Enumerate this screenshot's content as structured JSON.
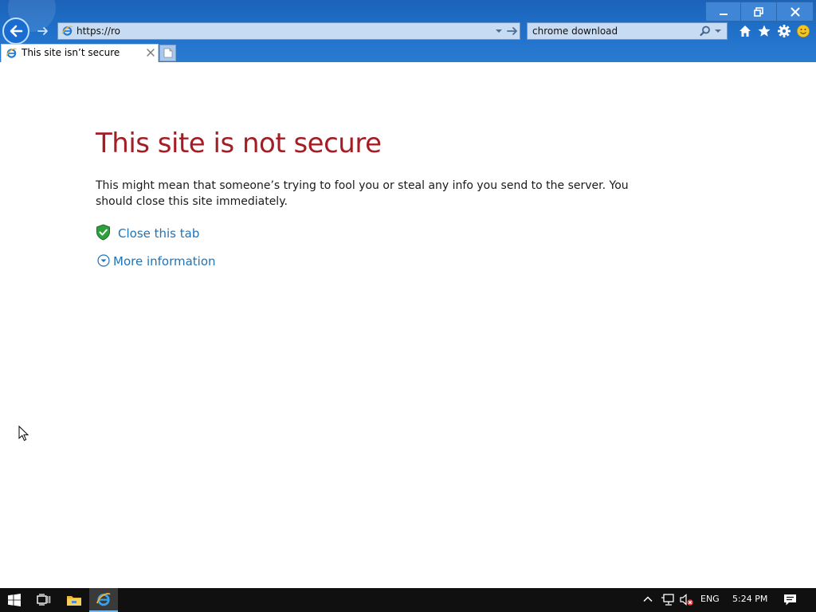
{
  "browser": {
    "address_value": "https://ro",
    "search_value": "chrome download",
    "tab_title": "This site isn’t secure"
  },
  "page": {
    "title": "This site is not secure",
    "body": "This might mean that someone’s trying to fool you or steal any info you send to the server. You should close this site immediately.",
    "close_tab_label": "Close this tab",
    "more_info_label": "More information"
  },
  "taskbar": {
    "language": "ENG",
    "time": "5:24 PM"
  },
  "colors": {
    "title_red": "#a51d24",
    "link_blue": "#1f73b7",
    "chrome_blue": "#1f6fc8",
    "taskbar": "#101010"
  },
  "icons": [
    "back-arrow-icon",
    "forward-arrow-icon",
    "ie-logo-icon",
    "search-icon",
    "home-icon",
    "favorites-star-icon",
    "gear-icon",
    "smiley-icon",
    "minimize-icon",
    "restore-icon",
    "close-icon",
    "new-tab-icon",
    "shield-check-icon",
    "chevron-down-circle-icon",
    "windows-logo-icon",
    "task-view-icon",
    "file-explorer-icon",
    "network-icon",
    "volume-muted-icon",
    "notifications-icon"
  ]
}
